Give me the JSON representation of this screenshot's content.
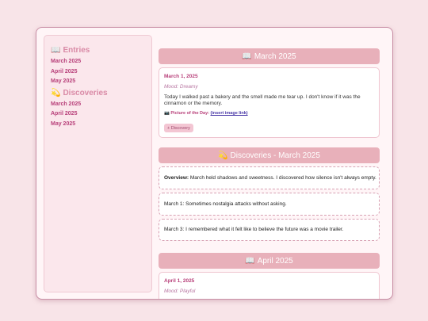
{
  "sidebar": {
    "entries_heading_icon": "📖",
    "entries_heading": "Entries",
    "entries": [
      "March 2025",
      "April 2025",
      "May 2025"
    ],
    "discoveries_heading_icon": "💫",
    "discoveries_heading": "Discoveries",
    "discoveries": [
      "March 2025",
      "April 2025",
      "May 2025"
    ]
  },
  "main": {
    "march_banner_icon": "📖",
    "march_banner": "March 2025",
    "march_entry": {
      "date": "March 1, 2025",
      "mood": "Mood: Dreamy",
      "text": "Today I walked past a bakery and the smell made me tear up. I don't know if it was the cinnamon or the memory.",
      "potd_icon": "📷",
      "potd_label": "Picture of the Day:",
      "potd_link": "(insert image link)",
      "discovery_button": "+ Discovery"
    },
    "discoveries_banner_icon": "💫",
    "discoveries_banner": "Discoveries - March 2025",
    "overview_label": "Overview:",
    "overview_text": "March held shadows and sweetness. I discovered how silence isn't always empty.",
    "discovery_items": [
      "March 1: Sometimes nostalgia attacks without asking.",
      "March 3: I remembered what it felt like to believe the future was a movie trailer."
    ],
    "april_banner_icon": "📖",
    "april_banner": "April 2025",
    "april_entry": {
      "date": "April 1, 2025",
      "mood": "Mood: Playful"
    }
  },
  "colors": {
    "background": "#f8e4e8",
    "banner": "#e8b0ba",
    "link": "#b8407a",
    "accent": "#d98aa6"
  }
}
